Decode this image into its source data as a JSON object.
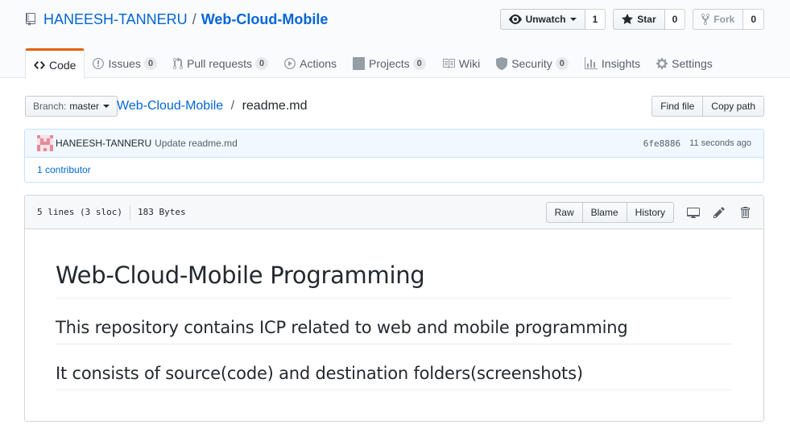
{
  "repo": {
    "owner": "HANEESH-TANNERU",
    "separator": "/",
    "name": "Web-Cloud-Mobile"
  },
  "actions": {
    "watch": {
      "label": "Unwatch",
      "count": "1",
      "icon": "eye-icon"
    },
    "star": {
      "label": "Star",
      "count": "0",
      "icon": "star-icon"
    },
    "fork": {
      "label": "Fork",
      "count": "0",
      "icon": "fork-icon"
    }
  },
  "tabs": [
    {
      "label": "Code",
      "icon": "code-icon",
      "counter": ""
    },
    {
      "label": "Issues",
      "icon": "issue-icon",
      "counter": "0"
    },
    {
      "label": "Pull requests",
      "icon": "pull-request-icon",
      "counter": "0"
    },
    {
      "label": "Actions",
      "icon": "play-icon",
      "counter": ""
    },
    {
      "label": "Projects",
      "icon": "project-icon",
      "counter": "0"
    },
    {
      "label": "Wiki",
      "icon": "book-icon",
      "counter": ""
    },
    {
      "label": "Security",
      "icon": "shield-icon",
      "counter": "0"
    },
    {
      "label": "Insights",
      "icon": "graph-icon",
      "counter": ""
    },
    {
      "label": "Settings",
      "icon": "gear-icon",
      "counter": ""
    }
  ],
  "filenav": {
    "branch_prefix": "Branch:",
    "branch": "master",
    "crumb_repo": "Web-Cloud-Mobile",
    "crumb_sep": "/",
    "crumb_file": "readme.md",
    "find_file": "Find file",
    "copy_path": "Copy path"
  },
  "commit": {
    "author": "HANEESH-TANNERU",
    "message": "Update readme.md",
    "sha": "6fe8886",
    "time": "11 seconds ago",
    "contributors": "1 contributor"
  },
  "file": {
    "lines": "5 lines (3 sloc)",
    "size": "183 Bytes",
    "raw": "Raw",
    "blame": "Blame",
    "history": "History"
  },
  "readme": {
    "h1": "Web-Cloud-Mobile Programming",
    "h2a": "This repository contains ICP related to web and mobile programming",
    "h2b": "It consists of source(code) and destination folders(screenshots)"
  },
  "colors": {
    "link": "#0366d6",
    "selected_tab_border": "#e36209",
    "commit_bg": "#f1f8ff"
  }
}
